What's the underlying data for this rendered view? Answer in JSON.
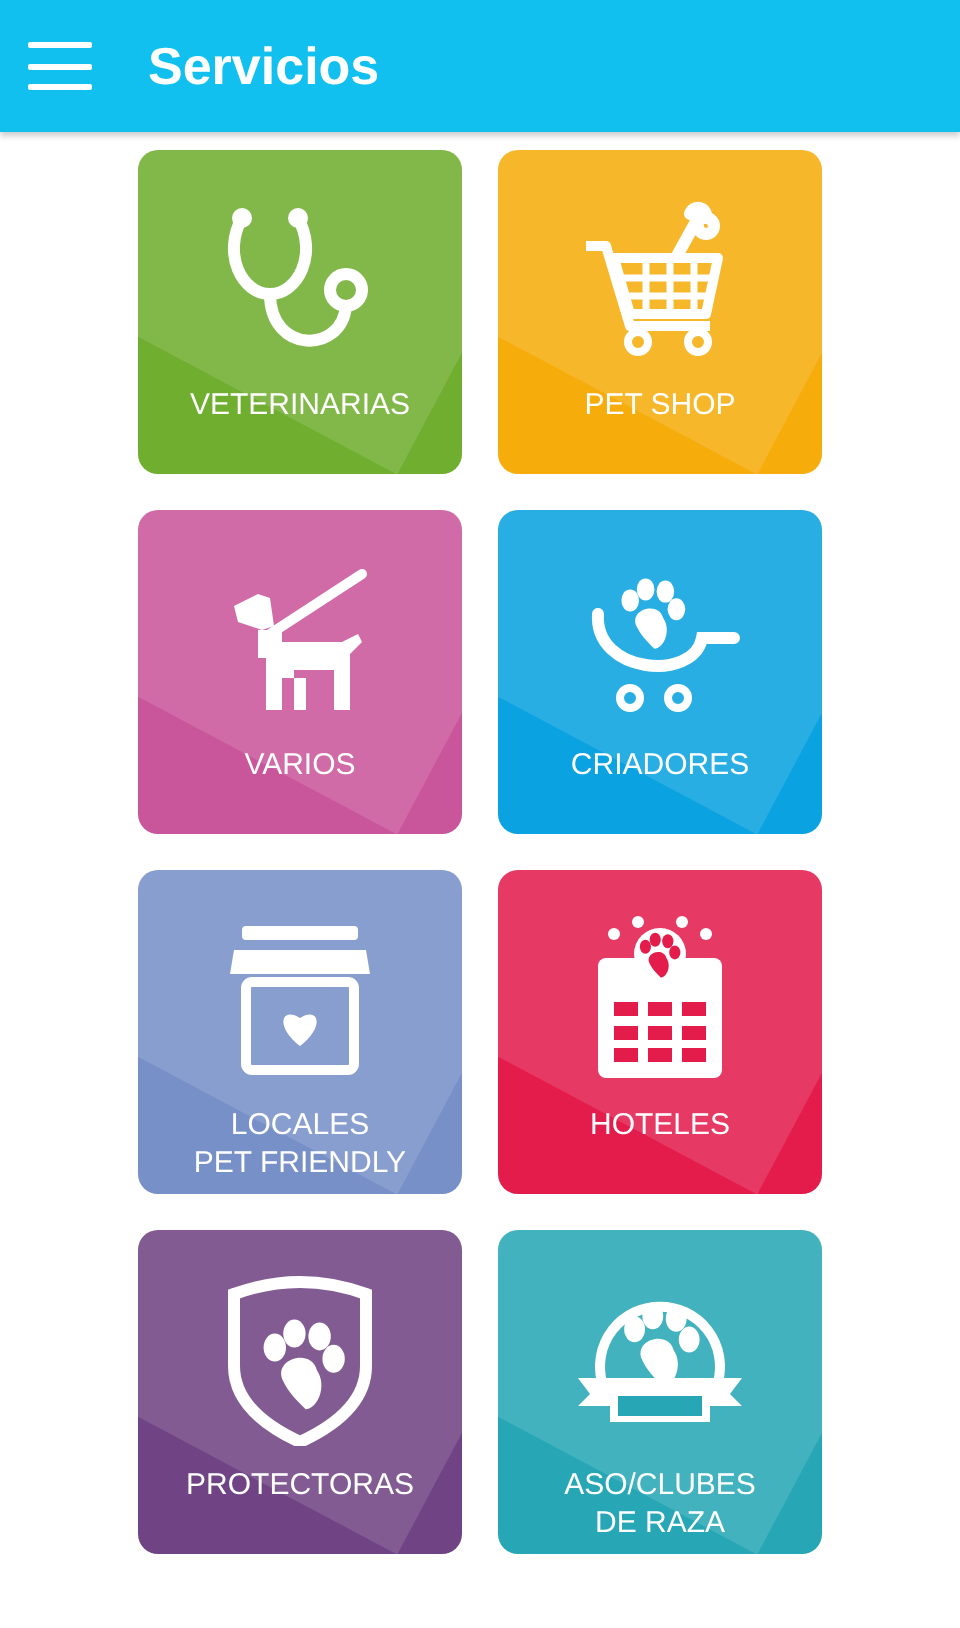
{
  "app_bar": {
    "title": "Servicios"
  },
  "tiles": [
    {
      "kind": "stethoscope",
      "label": [
        "VETERINARIAS"
      ],
      "color": "#6fae2f"
    },
    {
      "kind": "cart",
      "label": [
        "PET SHOP"
      ],
      "color": "#f6ad0c"
    },
    {
      "kind": "dog",
      "label": [
        "VARIOS"
      ],
      "color": "#c9559a"
    },
    {
      "kind": "stroller",
      "label": [
        "CRIADORES"
      ],
      "color": "#0aa2e0"
    },
    {
      "kind": "store",
      "label": [
        "LOCALES",
        "PET FRIENDLY"
      ],
      "color": "#7790c8"
    },
    {
      "kind": "hotel",
      "label": [
        "HOTELES"
      ],
      "color": "#e31c4c"
    },
    {
      "kind": "shield",
      "label": [
        "PROTECTORAS"
      ],
      "color": "#704384"
    },
    {
      "kind": "badge",
      "label": [
        "ASO/CLUBES",
        "DE RAZA"
      ],
      "color": "#27a7b6"
    }
  ]
}
